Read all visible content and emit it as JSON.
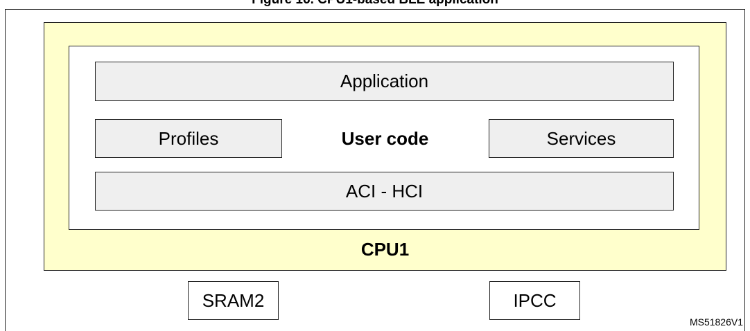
{
  "caption": "Figure 16. CPU1-based BLE application",
  "blocks": {
    "application": "Application",
    "profiles": "Profiles",
    "user_code": "User code",
    "services": "Services",
    "aci_hci": "ACI - HCI",
    "cpu1": "CPU1",
    "sram2": "SRAM2",
    "ipcc": "IPCC"
  },
  "figure_id": "MS51826V1",
  "colors": {
    "cpu_background": "#ffffcc",
    "block_background": "#efefef",
    "border": "#222222"
  }
}
